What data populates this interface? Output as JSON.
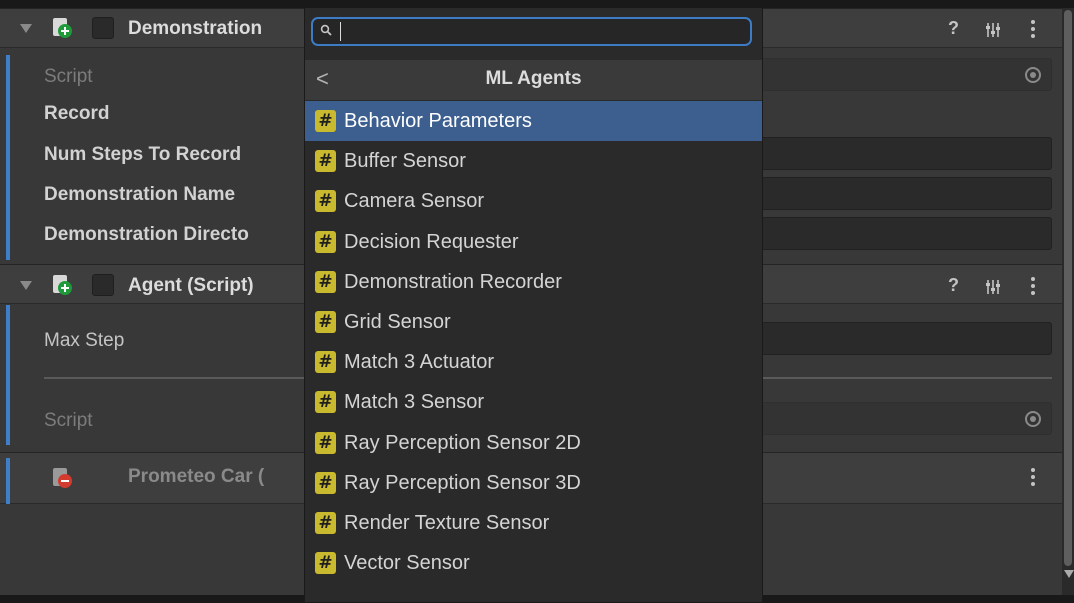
{
  "inspector": {
    "components": [
      {
        "title": "Demonstration",
        "fields": [
          {
            "label": "Script",
            "dim": true
          },
          {
            "label": "Record"
          },
          {
            "label": "Num Steps To Record"
          },
          {
            "label": "Demonstration Name"
          },
          {
            "label": "Demonstration Directo"
          }
        ]
      },
      {
        "title": "Agent (Script)",
        "fields": [
          {
            "label": "Max Step"
          },
          {
            "label": "Script",
            "dim": true
          }
        ]
      },
      {
        "title": "Prometeo Car ("
      }
    ],
    "header_icons": [
      "help-icon",
      "preset-icon",
      "kebab-menu-icon"
    ]
  },
  "popup": {
    "search": {
      "value": "",
      "placeholder": ""
    },
    "back_label": "<",
    "title": "ML Agents",
    "items": [
      {
        "label": "Behavior Parameters",
        "selected": true
      },
      {
        "label": "Buffer Sensor"
      },
      {
        "label": "Camera Sensor"
      },
      {
        "label": "Decision Requester"
      },
      {
        "label": "Demonstration Recorder"
      },
      {
        "label": "Grid Sensor"
      },
      {
        "label": "Match 3 Actuator"
      },
      {
        "label": "Match 3 Sensor"
      },
      {
        "label": "Ray Perception Sensor 2D"
      },
      {
        "label": "Ray Perception Sensor 3D"
      },
      {
        "label": "Render Texture Sensor"
      },
      {
        "label": "Vector Sensor"
      }
    ],
    "item_icon_glyph": "#"
  },
  "colors": {
    "selection": "#3d5f8f",
    "focus_outline": "#3d7bc4",
    "script_badge": "#c8b92f",
    "rail": "#3f7fc9"
  }
}
